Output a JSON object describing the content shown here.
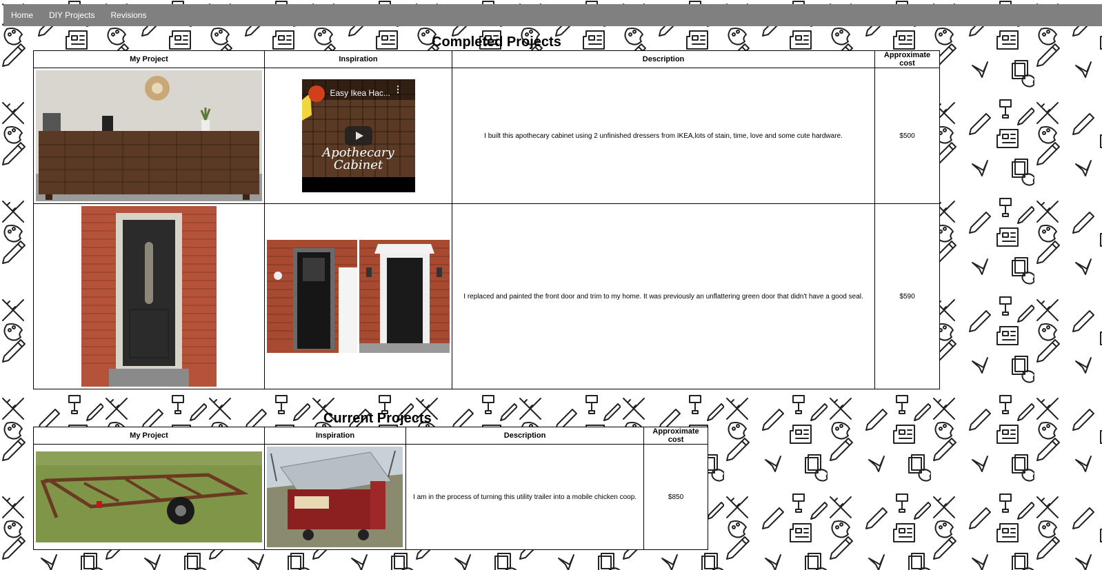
{
  "nav": {
    "items": [
      "Home",
      "DIY Projects",
      "Revisions"
    ]
  },
  "completed": {
    "title": "Completed Projects",
    "headers": [
      "My Project",
      "Inspiration",
      "Description",
      "Approximate cost"
    ],
    "rows": [
      {
        "description": "I built this apothecary cabinet using 2 unfinished dressers from IKEA,lots of stain, time, love and some cute hardware.",
        "cost": "$500",
        "video": {
          "title": "Easy Ikea Hac...",
          "overlay_line1": "Apothecary",
          "overlay_line2": "Cabinet"
        }
      },
      {
        "description": "I replaced and painted the front door and trim to my home. It was previously an unflattering green door that didn't have a good seal.",
        "cost": "$590"
      }
    ]
  },
  "current": {
    "title": "Current Projects",
    "headers": [
      "My Project",
      "Inspiration",
      "Description",
      "Approximate cost"
    ],
    "rows": [
      {
        "description": "I am in the process of turning this utility trailer into a mobile chicken coop.",
        "cost": "$850"
      }
    ]
  }
}
